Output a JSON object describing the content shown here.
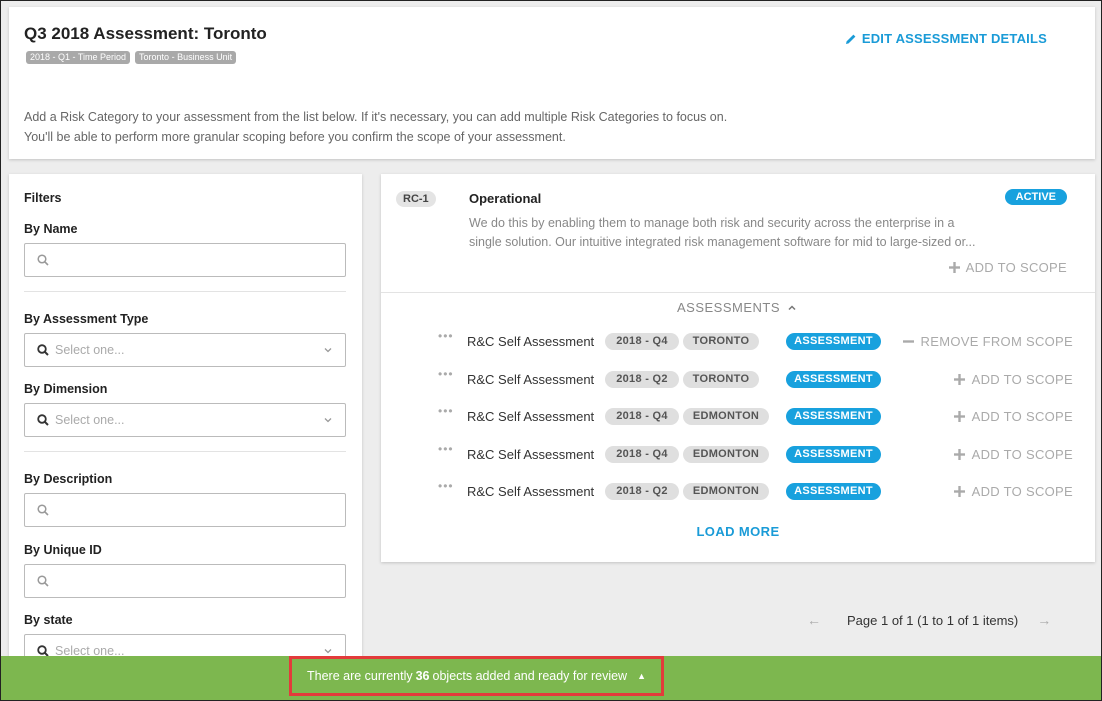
{
  "header": {
    "title": "Q3 2018 Assessment: Toronto",
    "tags": [
      "2018 - Q1 - Time Period",
      "Toronto - Business Unit"
    ],
    "edit_label": "EDIT ASSESSMENT DETAILS",
    "description_line1": "Add a Risk Category to your assessment from the list below. If it's necessary, you can add multiple Risk Categories to focus on.",
    "description_line2": "You'll be able to perform more granular scoping before you confirm the scope of your assessment."
  },
  "filters": {
    "title": "Filters",
    "by_name": "By Name",
    "by_assessment_type": "By Assessment Type",
    "by_dimension": "By Dimension",
    "by_description": "By Description",
    "by_unique_id": "By Unique ID",
    "by_state": "By state",
    "select_placeholder": "Select one..."
  },
  "risk_category": {
    "id_badge": "RC-1",
    "name": "Operational",
    "status": "ACTIVE",
    "description_line1": "We do this by enabling them to manage both risk and security across the enterprise in a",
    "description_line2": "single solution. Our intuitive integrated risk management software for mid to large-sized or...",
    "add_label": "ADD TO SCOPE"
  },
  "assessments": {
    "heading": "ASSESSMENTS",
    "rows": [
      {
        "name": "R&C Self Assessment",
        "period": "2018 - Q4",
        "unit": "TORONTO",
        "type": "ASSESSMENT",
        "action": "REMOVE FROM SCOPE"
      },
      {
        "name": "R&C Self Assessment",
        "period": "2018 - Q2",
        "unit": "TORONTO",
        "type": "ASSESSMENT",
        "action": "ADD TO SCOPE"
      },
      {
        "name": "R&C Self Assessment",
        "period": "2018 - Q4",
        "unit": "EDMONTON",
        "type": "ASSESSMENT",
        "action": "ADD TO SCOPE"
      },
      {
        "name": "R&C Self Assessment",
        "period": "2018 - Q4",
        "unit": "EDMONTON",
        "type": "ASSESSMENT",
        "action": "ADD TO SCOPE"
      },
      {
        "name": "R&C Self Assessment",
        "period": "2018 - Q2",
        "unit": "EDMONTON",
        "type": "ASSESSMENT",
        "action": "ADD TO SCOPE"
      }
    ],
    "load_more": "LOAD MORE"
  },
  "pagination": {
    "text": "Page 1 of 1 (1 to 1 of 1 items)"
  },
  "footer": {
    "prefix": "There are currently",
    "count": "36",
    "suffix": "objects added and ready for review"
  },
  "colors": {
    "accent": "#1a9bd7",
    "footer_bar": "#7db74f",
    "highlight_border": "#e23b3b"
  }
}
